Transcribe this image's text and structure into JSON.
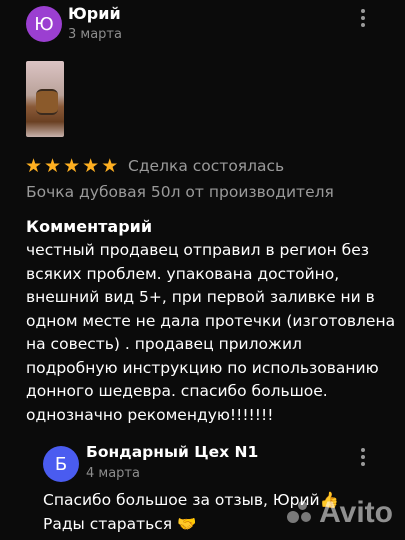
{
  "review": {
    "author_initial": "Ю",
    "author_name": "Юрий",
    "date": "3 марта",
    "avatar_color": "#9b3fd1",
    "rating": 5,
    "deal_status": "Сделка состоялась",
    "product_title": "Бочка дубовая 50л от производителя",
    "comment_heading": "Комментарий",
    "comment_lines": [
      "честный продавец отправил в регион без",
      "всяких проблем. упакована достойно,",
      "внешний вид 5+, при первой заливке ни в",
      "одном месте не дала протечки (изготовлена",
      "на совесть) . продавец приложил",
      "подробную инструкцию по использованию",
      "донного шедевра. спасибо большое.",
      "однозначно рекомендую!!!!!!!"
    ]
  },
  "reply": {
    "author_initial": "Б",
    "author_name": "Бондарный Цех N1",
    "date": "4 марта",
    "avatar_color": "#4a5cf0",
    "lines": [
      "Спасибо большое за отзыв, Юрий👍",
      "Рады стараться 🤝"
    ]
  },
  "watermark": {
    "brand": "Avito"
  },
  "icons": {
    "star": "star-icon",
    "more": "more-vertical-icon"
  },
  "colors": {
    "star": "#ffb021",
    "background": "#0b0b0b",
    "muted": "#9a9a9a"
  }
}
